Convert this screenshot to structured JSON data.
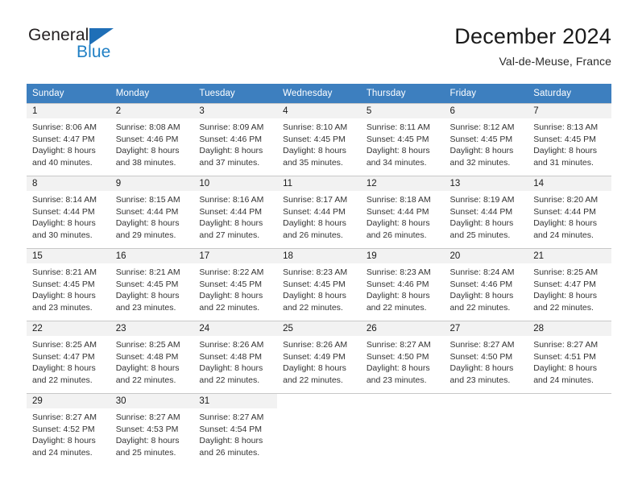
{
  "brand": {
    "name_part1": "General",
    "name_part2": "Blue",
    "triangle_color": "#1f6fb7",
    "blue_color": "#1f7fc4"
  },
  "header": {
    "title": "December 2024",
    "subtitle": "Val-de-Meuse, France"
  },
  "colors": {
    "header_row_bg": "#3d7fbf",
    "header_row_text": "#ffffff",
    "daynum_band_bg": "#f2f2f2",
    "grid_line": "#c8c8c8"
  },
  "weekday_headers": [
    "Sunday",
    "Monday",
    "Tuesday",
    "Wednesday",
    "Thursday",
    "Friday",
    "Saturday"
  ],
  "weeks": [
    [
      {
        "day": "1",
        "sunrise": "Sunrise: 8:06 AM",
        "sunset": "Sunset: 4:47 PM",
        "daylight1": "Daylight: 8 hours",
        "daylight2": "and 40 minutes."
      },
      {
        "day": "2",
        "sunrise": "Sunrise: 8:08 AM",
        "sunset": "Sunset: 4:46 PM",
        "daylight1": "Daylight: 8 hours",
        "daylight2": "and 38 minutes."
      },
      {
        "day": "3",
        "sunrise": "Sunrise: 8:09 AM",
        "sunset": "Sunset: 4:46 PM",
        "daylight1": "Daylight: 8 hours",
        "daylight2": "and 37 minutes."
      },
      {
        "day": "4",
        "sunrise": "Sunrise: 8:10 AM",
        "sunset": "Sunset: 4:45 PM",
        "daylight1": "Daylight: 8 hours",
        "daylight2": "and 35 minutes."
      },
      {
        "day": "5",
        "sunrise": "Sunrise: 8:11 AM",
        "sunset": "Sunset: 4:45 PM",
        "daylight1": "Daylight: 8 hours",
        "daylight2": "and 34 minutes."
      },
      {
        "day": "6",
        "sunrise": "Sunrise: 8:12 AM",
        "sunset": "Sunset: 4:45 PM",
        "daylight1": "Daylight: 8 hours",
        "daylight2": "and 32 minutes."
      },
      {
        "day": "7",
        "sunrise": "Sunrise: 8:13 AM",
        "sunset": "Sunset: 4:45 PM",
        "daylight1": "Daylight: 8 hours",
        "daylight2": "and 31 minutes."
      }
    ],
    [
      {
        "day": "8",
        "sunrise": "Sunrise: 8:14 AM",
        "sunset": "Sunset: 4:44 PM",
        "daylight1": "Daylight: 8 hours",
        "daylight2": "and 30 minutes."
      },
      {
        "day": "9",
        "sunrise": "Sunrise: 8:15 AM",
        "sunset": "Sunset: 4:44 PM",
        "daylight1": "Daylight: 8 hours",
        "daylight2": "and 29 minutes."
      },
      {
        "day": "10",
        "sunrise": "Sunrise: 8:16 AM",
        "sunset": "Sunset: 4:44 PM",
        "daylight1": "Daylight: 8 hours",
        "daylight2": "and 27 minutes."
      },
      {
        "day": "11",
        "sunrise": "Sunrise: 8:17 AM",
        "sunset": "Sunset: 4:44 PM",
        "daylight1": "Daylight: 8 hours",
        "daylight2": "and 26 minutes."
      },
      {
        "day": "12",
        "sunrise": "Sunrise: 8:18 AM",
        "sunset": "Sunset: 4:44 PM",
        "daylight1": "Daylight: 8 hours",
        "daylight2": "and 26 minutes."
      },
      {
        "day": "13",
        "sunrise": "Sunrise: 8:19 AM",
        "sunset": "Sunset: 4:44 PM",
        "daylight1": "Daylight: 8 hours",
        "daylight2": "and 25 minutes."
      },
      {
        "day": "14",
        "sunrise": "Sunrise: 8:20 AM",
        "sunset": "Sunset: 4:44 PM",
        "daylight1": "Daylight: 8 hours",
        "daylight2": "and 24 minutes."
      }
    ],
    [
      {
        "day": "15",
        "sunrise": "Sunrise: 8:21 AM",
        "sunset": "Sunset: 4:45 PM",
        "daylight1": "Daylight: 8 hours",
        "daylight2": "and 23 minutes."
      },
      {
        "day": "16",
        "sunrise": "Sunrise: 8:21 AM",
        "sunset": "Sunset: 4:45 PM",
        "daylight1": "Daylight: 8 hours",
        "daylight2": "and 23 minutes."
      },
      {
        "day": "17",
        "sunrise": "Sunrise: 8:22 AM",
        "sunset": "Sunset: 4:45 PM",
        "daylight1": "Daylight: 8 hours",
        "daylight2": "and 22 minutes."
      },
      {
        "day": "18",
        "sunrise": "Sunrise: 8:23 AM",
        "sunset": "Sunset: 4:45 PM",
        "daylight1": "Daylight: 8 hours",
        "daylight2": "and 22 minutes."
      },
      {
        "day": "19",
        "sunrise": "Sunrise: 8:23 AM",
        "sunset": "Sunset: 4:46 PM",
        "daylight1": "Daylight: 8 hours",
        "daylight2": "and 22 minutes."
      },
      {
        "day": "20",
        "sunrise": "Sunrise: 8:24 AM",
        "sunset": "Sunset: 4:46 PM",
        "daylight1": "Daylight: 8 hours",
        "daylight2": "and 22 minutes."
      },
      {
        "day": "21",
        "sunrise": "Sunrise: 8:25 AM",
        "sunset": "Sunset: 4:47 PM",
        "daylight1": "Daylight: 8 hours",
        "daylight2": "and 22 minutes."
      }
    ],
    [
      {
        "day": "22",
        "sunrise": "Sunrise: 8:25 AM",
        "sunset": "Sunset: 4:47 PM",
        "daylight1": "Daylight: 8 hours",
        "daylight2": "and 22 minutes."
      },
      {
        "day": "23",
        "sunrise": "Sunrise: 8:25 AM",
        "sunset": "Sunset: 4:48 PM",
        "daylight1": "Daylight: 8 hours",
        "daylight2": "and 22 minutes."
      },
      {
        "day": "24",
        "sunrise": "Sunrise: 8:26 AM",
        "sunset": "Sunset: 4:48 PM",
        "daylight1": "Daylight: 8 hours",
        "daylight2": "and 22 minutes."
      },
      {
        "day": "25",
        "sunrise": "Sunrise: 8:26 AM",
        "sunset": "Sunset: 4:49 PM",
        "daylight1": "Daylight: 8 hours",
        "daylight2": "and 22 minutes."
      },
      {
        "day": "26",
        "sunrise": "Sunrise: 8:27 AM",
        "sunset": "Sunset: 4:50 PM",
        "daylight1": "Daylight: 8 hours",
        "daylight2": "and 23 minutes."
      },
      {
        "day": "27",
        "sunrise": "Sunrise: 8:27 AM",
        "sunset": "Sunset: 4:50 PM",
        "daylight1": "Daylight: 8 hours",
        "daylight2": "and 23 minutes."
      },
      {
        "day": "28",
        "sunrise": "Sunrise: 8:27 AM",
        "sunset": "Sunset: 4:51 PM",
        "daylight1": "Daylight: 8 hours",
        "daylight2": "and 24 minutes."
      }
    ],
    [
      {
        "day": "29",
        "sunrise": "Sunrise: 8:27 AM",
        "sunset": "Sunset: 4:52 PM",
        "daylight1": "Daylight: 8 hours",
        "daylight2": "and 24 minutes."
      },
      {
        "day": "30",
        "sunrise": "Sunrise: 8:27 AM",
        "sunset": "Sunset: 4:53 PM",
        "daylight1": "Daylight: 8 hours",
        "daylight2": "and 25 minutes."
      },
      {
        "day": "31",
        "sunrise": "Sunrise: 8:27 AM",
        "sunset": "Sunset: 4:54 PM",
        "daylight1": "Daylight: 8 hours",
        "daylight2": "and 26 minutes."
      },
      {
        "day": "",
        "sunrise": "",
        "sunset": "",
        "daylight1": "",
        "daylight2": ""
      },
      {
        "day": "",
        "sunrise": "",
        "sunset": "",
        "daylight1": "",
        "daylight2": ""
      },
      {
        "day": "",
        "sunrise": "",
        "sunset": "",
        "daylight1": "",
        "daylight2": ""
      },
      {
        "day": "",
        "sunrise": "",
        "sunset": "",
        "daylight1": "",
        "daylight2": ""
      }
    ]
  ]
}
